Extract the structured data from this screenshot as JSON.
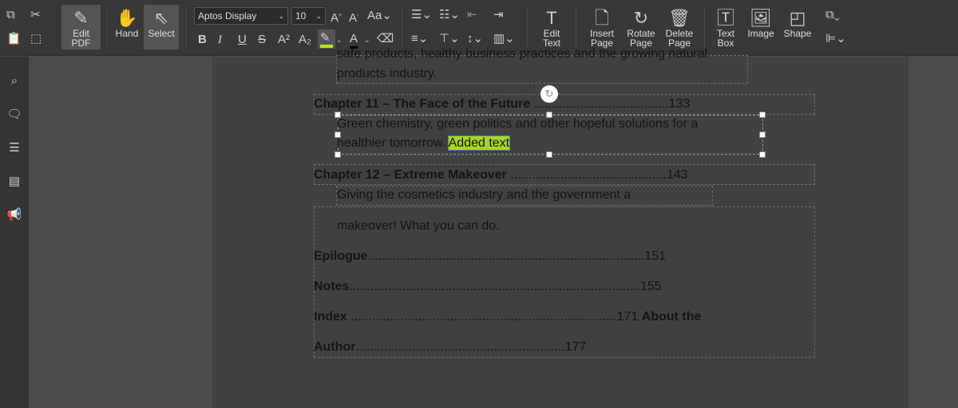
{
  "toolbar": {
    "edit_pdf": "Edit PDF",
    "hand": "Hand",
    "select": "Select",
    "font_family": "Aptos Display",
    "font_size": "10",
    "edit_text": "Edit Text",
    "insert_page": "Insert Page",
    "rotate_page": "Rotate Page",
    "delete_page": "Delete Page",
    "text_box": "Text Box",
    "image": "Image",
    "shape": "Shape",
    "highlight_color": "#b5e61d",
    "font_color": "#000000"
  },
  "document": {
    "line_cut": "safe products, healthy business practices and the growing natural",
    "line_products": "products industry.",
    "ch11_title": "Chapter 11 – The Face of the Future",
    "ch11_dots": " ......................................133",
    "ch11_desc1": "Green chemistry, green politics and other hopeful solutions for a",
    "ch11_desc2": "healthier tomorrow. ",
    "added_text": "Added text",
    "ch12_title": "Chapter 12 – Extreme Makeover",
    "ch12_dots": " ............................................143",
    "ch12_desc1": "Giving the cosmetics industry and the government a",
    "ch12_desc2": "makeover! What you can do.",
    "epilogue": "Epilogue",
    "epilogue_dots": "..............................................................................151",
    "notes": "Notes",
    "notes_dots": "..................................................................................155",
    "index": "Index",
    "index_dots": " ...........................................................................171 ",
    "about1": "About the",
    "about2": "Author",
    "about_dots": "...........................................................177"
  }
}
